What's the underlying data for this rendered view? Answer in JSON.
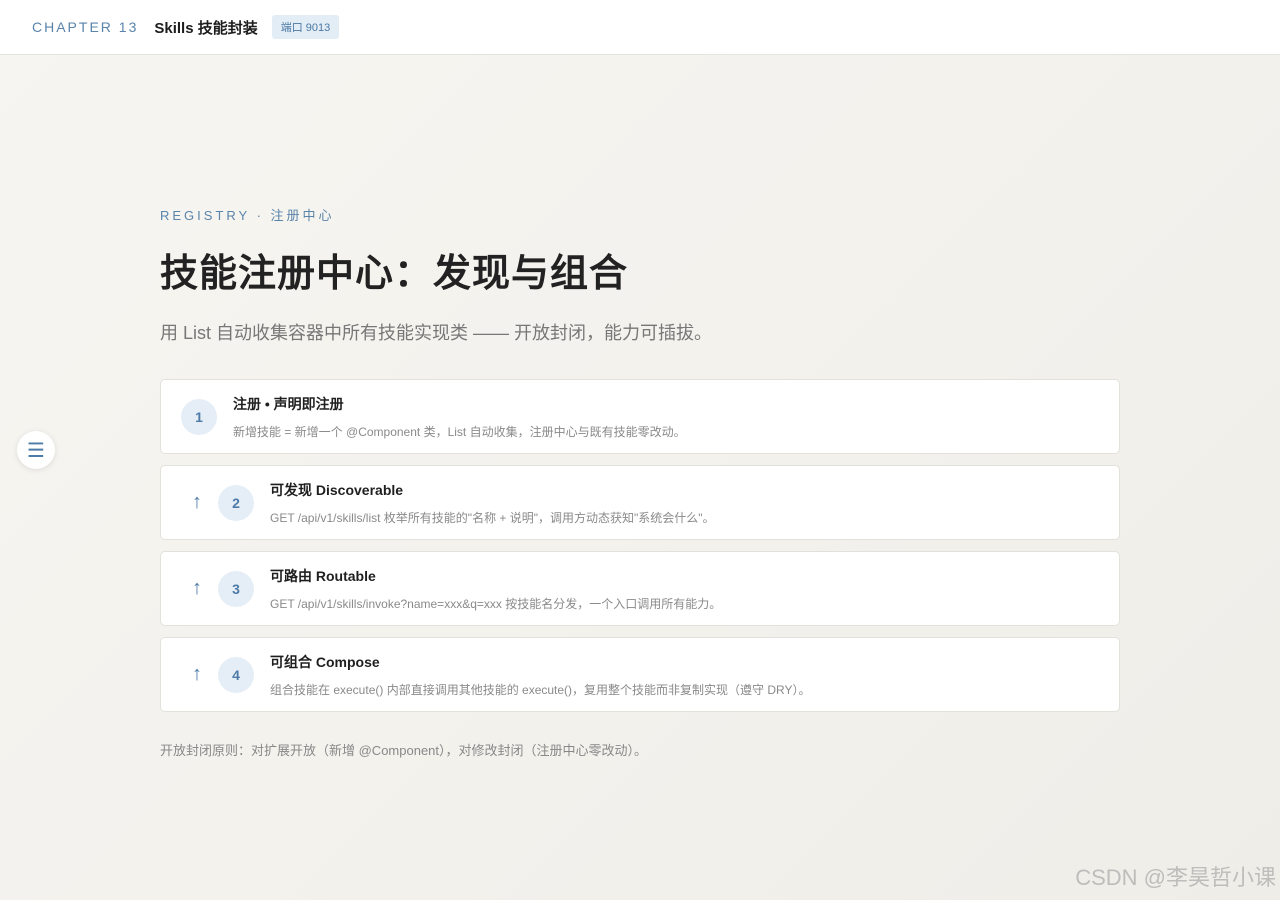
{
  "header": {
    "chapter": "CHAPTER 13",
    "title": "Skills 技能封装",
    "port_badge": "端口 9013"
  },
  "side_toggle": {
    "icon": "menu-icon",
    "glyph": "☰"
  },
  "main": {
    "eyebrow": "REGISTRY · 注册中心",
    "title": "技能注册中心：发现与组合",
    "subtitle": "用 List 自动收集容器中所有技能实现类 —— 开放封闭，能力可插拔。",
    "cards": [
      {
        "num": "1",
        "arrow": "",
        "title": "注册 • 声明即注册",
        "desc": "新增技能 = 新增一个 @Component 类，List 自动收集，注册中心与既有技能零改动。"
      },
      {
        "num": "2",
        "arrow": "↑",
        "title": "可发现 Discoverable",
        "desc": "GET /api/v1/skills/list 枚举所有技能的\"名称 + 说明\"，调用方动态获知\"系统会什么\"。"
      },
      {
        "num": "3",
        "arrow": "↑",
        "title": "可路由 Routable",
        "desc": "GET /api/v1/skills/invoke?name=xxx&q=xxx 按技能名分发，一个入口调用所有能力。"
      },
      {
        "num": "4",
        "arrow": "↑",
        "title": "可组合 Compose",
        "desc": "组合技能在 execute() 内部直接调用其他技能的 execute()，复用整个技能而非复制实现（遵守 DRY）。"
      }
    ],
    "footnote": "开放封闭原则：对扩展开放（新增 @Component），对修改封闭（注册中心零改动）。"
  },
  "watermark": "CSDN @李昊哲小课",
  "colors": {
    "accent": "#4d7aa6",
    "badge_bg": "#e3edf6",
    "background": "#f4f2ed"
  }
}
